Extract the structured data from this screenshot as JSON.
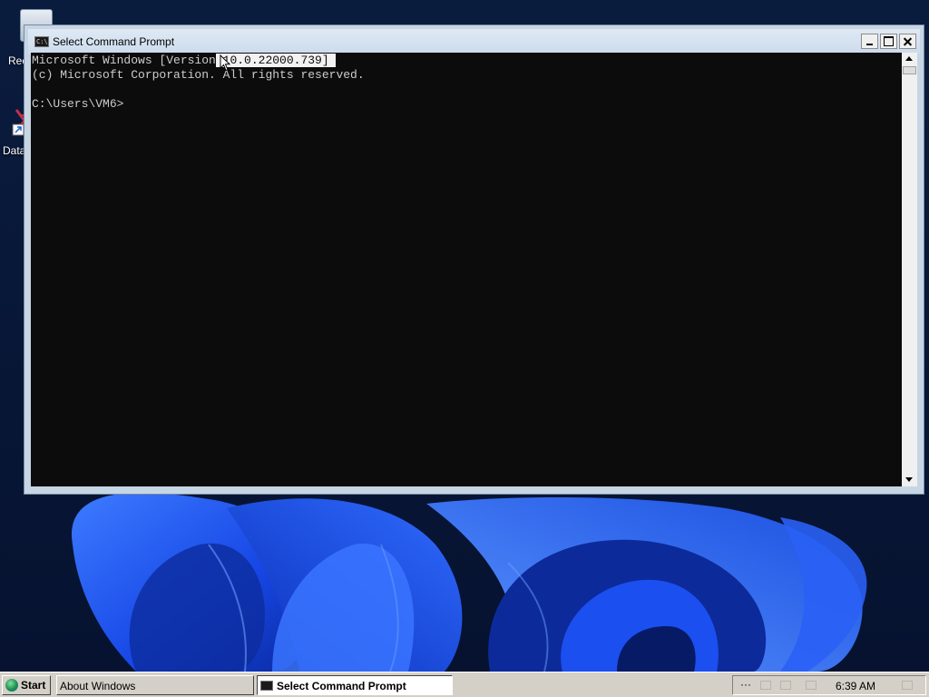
{
  "desktop": {
    "icons": [
      {
        "label": "Rec"
      },
      {
        "label": "Data"
      }
    ]
  },
  "cmd_window": {
    "title": "Select Command Prompt",
    "console": {
      "line1_before_selection": "Microsoft Windows [Version",
      "line1_selected": " 10.0.22000.739] ",
      "line2": "(c) Microsoft Corporation. All rights reserved.",
      "prompt": "C:\\Users\\VM6>"
    },
    "icons": {
      "title_icon_text": "C:\\"
    }
  },
  "taskbar": {
    "start_label": "Start",
    "tasks": [
      {
        "label": "About Windows",
        "active": false
      },
      {
        "label": "Select Command Prompt",
        "active": true
      }
    ],
    "tray": {
      "overflow": "···",
      "clock": "6:39 AM"
    }
  },
  "colors": {
    "console_bg": "#0c0c0c",
    "console_text": "#cccccc",
    "selection_bg": "#f2f2f2",
    "titlebar": "#cbdbec",
    "taskbar": "#d4d0c8",
    "wallpaper_blue": "#1a4fe0"
  }
}
